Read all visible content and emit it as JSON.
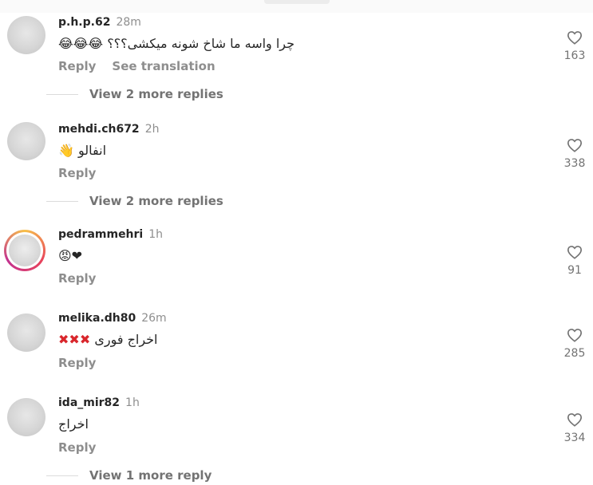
{
  "comments": [
    {
      "username": "p.h.p.62",
      "time": "28m",
      "text": "چرا واسه ما شاخ شونه میکشی؟؟؟",
      "emoji_suffix": "😂😂😂",
      "reply_label": "Reply",
      "see_translation_label": "See translation",
      "likes": "163",
      "view_replies": "View 2 more replies"
    },
    {
      "username": "mehdi.ch672",
      "time": "2h",
      "text": "انفالو",
      "emoji_suffix": "👋",
      "reply_label": "Reply",
      "likes": "338",
      "view_replies": "View 2 more replies"
    },
    {
      "username": "pedrammehri",
      "time": "1h",
      "text": "",
      "emoji_suffix": "😡❤",
      "reply_label": "Reply",
      "likes": "91"
    },
    {
      "username": "melika.dh80",
      "time": "26m",
      "text": "اخراج فوری",
      "emoji_suffix": "✖✖✖",
      "reply_label": "Reply",
      "likes": "285"
    },
    {
      "username": "ida_mir82",
      "time": "1h",
      "text": "اخراج",
      "emoji_suffix": "",
      "reply_label": "Reply",
      "likes": "334",
      "view_replies": "View 1 more reply"
    }
  ],
  "icons": {
    "like": "heart-outline-icon",
    "avatar": "profile-avatar"
  },
  "colors": {
    "text": "#262626",
    "muted": "#8e8e8e",
    "story_ring": "#e8435b",
    "x_mark": "#d9262c"
  }
}
